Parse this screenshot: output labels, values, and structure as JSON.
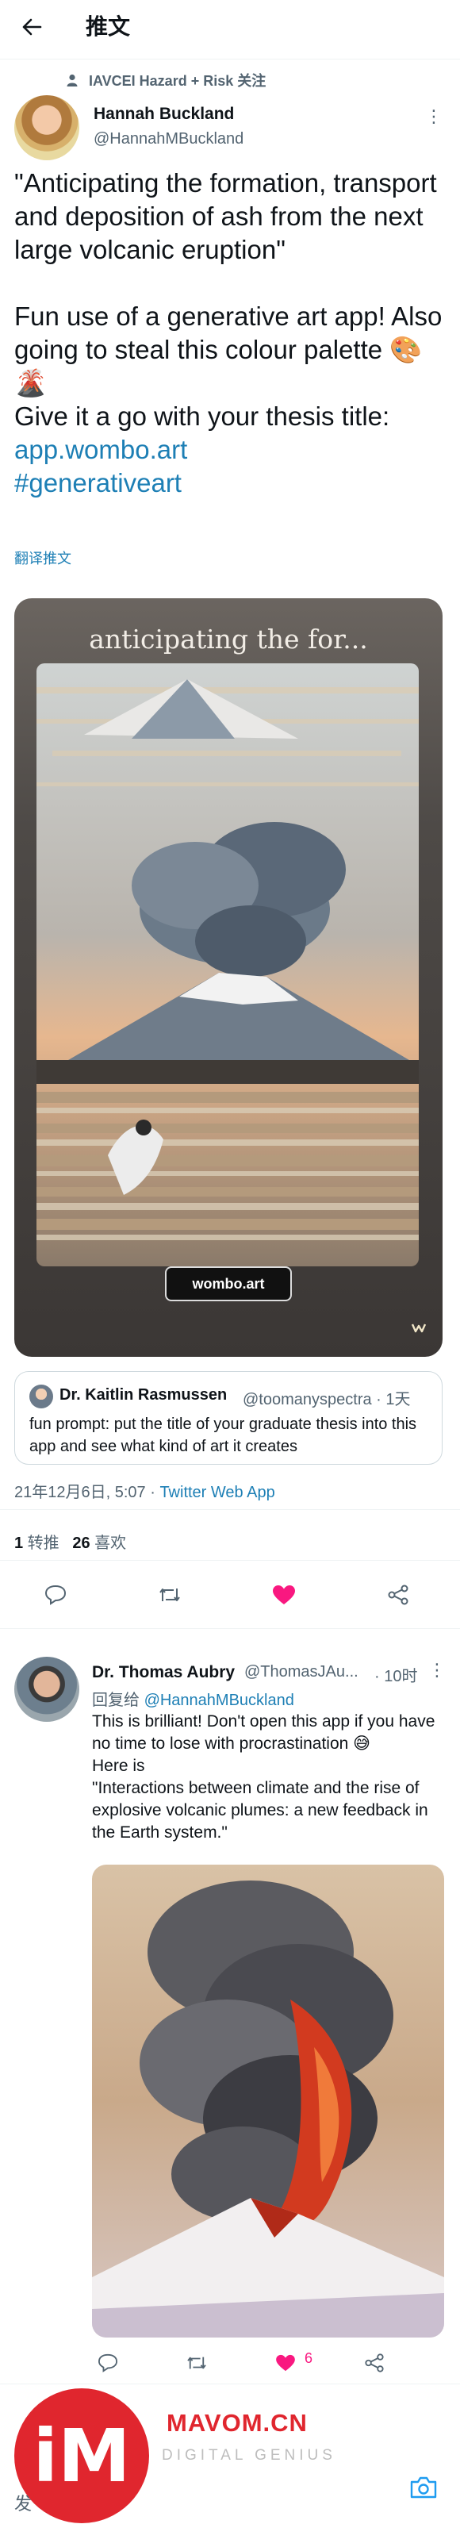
{
  "header": {
    "title": "推文"
  },
  "context": {
    "text": "IAVCEI Hazard + Risk 关注"
  },
  "tweet": {
    "author_name": "Hannah Buckland",
    "author_handle": "@HannahMBuckland",
    "text": "\"Anticipating the formation, transport and deposition of ash from the next large volcanic eruption\"\n\nFun use of a generative art app! Also going to steal this colour palette 🎨🌋\nGive it a go with your thesis title:",
    "link_1": "app.wombo.art",
    "link_2": "#generativeart",
    "translate": "翻译推文",
    "card_title": "anticipating the for...",
    "card_badge": "wombo.art",
    "quote": {
      "name": "Dr. Kaitlin Rasmussen",
      "handle": "@toomanyspectra · 1天",
      "text": "fun prompt: put the title of your graduate thesis into this app and see what kind of art it creates"
    },
    "date": "21年12月6日, 5:07 · ",
    "source": "Twitter Web App",
    "retweets": "1",
    "retweets_label": " 转推",
    "likes": "26",
    "likes_label": " 喜欢"
  },
  "reply": {
    "author_name": "Dr. Thomas Aubry",
    "author_handle": "@ThomasJAu...",
    "time": "· 10时",
    "reply_to_label": "回复给 ",
    "reply_to_handle": "@HannahMBuckland",
    "text": "This is brilliant! Don't open this app if you have no time to lose with procrastination 😅\nHere is\n\"Interactions between climate and the rise of explosive volcanic plumes: a new feedback in the Earth system.\"",
    "like_count": "6"
  },
  "watermark": {
    "logo_text": "iM",
    "brand": "MAVOM.CN",
    "tagline": "DIGITAL GENIUS"
  },
  "bottom": {
    "compose_label": "发"
  },
  "colors": {
    "accent": "#1d7fb5",
    "like": "#f91880",
    "brand": "#e0262e"
  }
}
